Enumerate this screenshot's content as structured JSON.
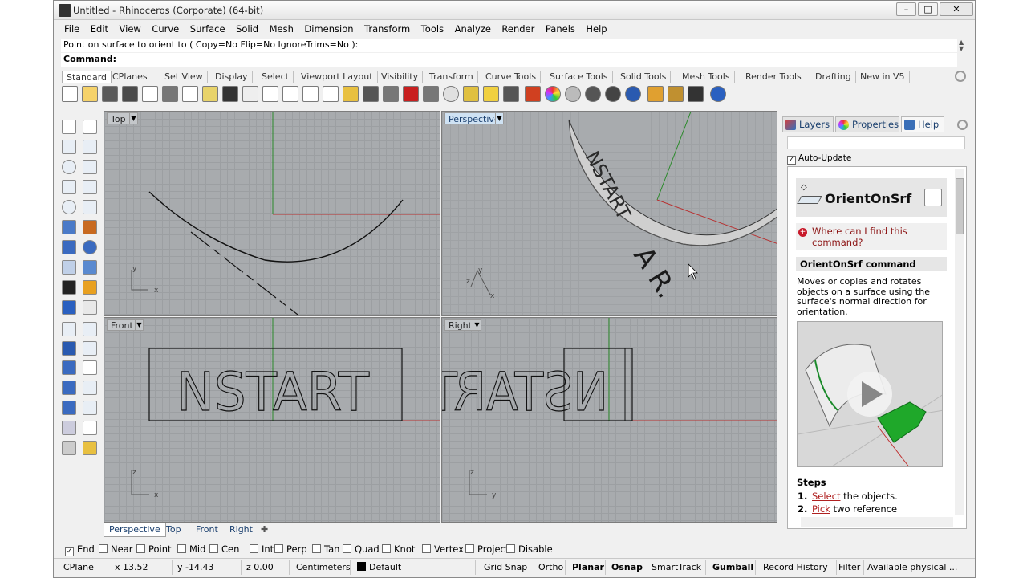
{
  "window": {
    "title": "Untitled - Rhinoceros (Corporate) (64-bit)",
    "controls": [
      "–",
      "□",
      "✕"
    ]
  },
  "menu": [
    "File",
    "Edit",
    "View",
    "Curve",
    "Surface",
    "Solid",
    "Mesh",
    "Dimension",
    "Transform",
    "Tools",
    "Analyze",
    "Render",
    "Panels",
    "Help"
  ],
  "command": {
    "history": "Point on surface to orient to ( Copy=No  Flip=No  IgnoreTrims=No ):",
    "prompt": "Command:"
  },
  "toolbar_tabs": [
    "Standard",
    "CPlanes",
    "Set View",
    "Display",
    "Select",
    "Viewport Layout",
    "Visibility",
    "Transform",
    "Curve Tools",
    "Surface Tools",
    "Solid Tools",
    "Mesh Tools",
    "Render Tools",
    "Drafting",
    "New in V5"
  ],
  "toolbar_icons": [
    "new-icon",
    "open-icon",
    "save-icon",
    "print-icon",
    "import-icon",
    "cut-icon",
    "copy-icon",
    "paste-icon",
    "undo-icon",
    "pan-icon",
    "rotate-view-icon",
    "zoom-icon",
    "zoom-window-icon",
    "zoom-extents-icon",
    "zoom-selected-icon",
    "rotate-icon",
    "four-viewports-icon",
    "car-icon",
    "cage-icon",
    "circle-icon",
    "grid-snap-icon",
    "light-icon",
    "lock-icon",
    "layer-icon",
    "color-wheel-icon",
    "wireframe-sphere-icon",
    "shaded-sphere-icon",
    "rendered-sphere-icon",
    "blue-sphere-icon",
    "point-icon",
    "settings-gear-icon",
    "dimension-icon",
    "help-icon"
  ],
  "viewports": {
    "top": {
      "label": "Top",
      "axis_x": "x",
      "axis_y": "y"
    },
    "perspective": {
      "label": "Perspective",
      "axis_x": "x",
      "axis_y": "y",
      "axis_z": "z"
    },
    "front": {
      "label": "Front",
      "axis_x": "x",
      "axis_y": "z",
      "text": "NSTART"
    },
    "right": {
      "label": "Right",
      "axis_x": "y",
      "axis_y": "z",
      "text": "NSTART"
    }
  },
  "viewport_tabs": [
    "Perspective",
    "Top",
    "Front",
    "Right"
  ],
  "osnaps": [
    {
      "label": "End",
      "checked": true
    },
    {
      "label": "Near",
      "checked": false
    },
    {
      "label": "Point",
      "checked": false
    },
    {
      "label": "Mid",
      "checked": false
    },
    {
      "label": "Cen",
      "checked": false
    },
    {
      "label": "Int",
      "checked": false
    },
    {
      "label": "Perp",
      "checked": false
    },
    {
      "label": "Tan",
      "checked": false
    },
    {
      "label": "Quad",
      "checked": false
    },
    {
      "label": "Knot",
      "checked": false
    },
    {
      "label": "Vertex",
      "checked": false
    },
    {
      "label": "Project",
      "checked": false
    },
    {
      "label": "Disable",
      "checked": false
    }
  ],
  "status": {
    "cplane": "CPlane",
    "x": "x 13.52",
    "y": "y -14.43",
    "z": "z 0.00",
    "units": "Centimeters",
    "layer": "Default",
    "layer_color": "#000000",
    "grid_snap": "Grid Snap",
    "ortho": "Ortho",
    "planar": "Planar",
    "osnap": "Osnap",
    "smarttrack": "SmartTrack",
    "gumball": "Gumball",
    "record_history": "Record History",
    "filter": "Filter",
    "memory": "Available physical ..."
  },
  "panel": {
    "tabs": [
      "Layers",
      "Properties",
      "Help"
    ],
    "auto_update": "Auto-Update",
    "help": {
      "title": "OrientOnSrf",
      "where": "Where can I find this command?",
      "cmd_title": "OrientOnSrf command",
      "description": "Moves or copies and rotates objects on a surface using the surface's normal direction for orientation.",
      "steps_title": "Steps",
      "steps": [
        {
          "num": "1.",
          "link": "Select",
          "rest": " the objects."
        },
        {
          "num": "2.",
          "link": "Pick",
          "rest": " two reference"
        }
      ]
    }
  },
  "colors": {
    "viewport_bg": "#a8abae",
    "grid_line": "#9c9fa2",
    "x_axis": "#b83030",
    "y_axis": "#2a8a2a",
    "active_label": "#cfe2f3",
    "link_red": "#b02020",
    "help_r_green": "#1fa82a"
  }
}
